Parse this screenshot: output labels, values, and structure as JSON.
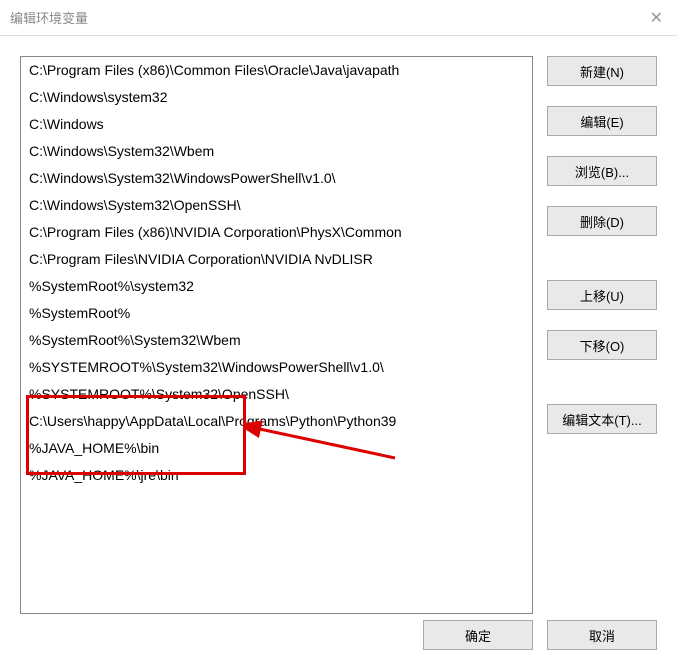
{
  "window": {
    "title": "编辑环境变量",
    "close_glyph": "✕"
  },
  "paths": [
    "C:\\Program Files (x86)\\Common Files\\Oracle\\Java\\javapath",
    "C:\\Windows\\system32",
    "C:\\Windows",
    "C:\\Windows\\System32\\Wbem",
    "C:\\Windows\\System32\\WindowsPowerShell\\v1.0\\",
    "C:\\Windows\\System32\\OpenSSH\\",
    "C:\\Program Files (x86)\\NVIDIA Corporation\\PhysX\\Common",
    "C:\\Program Files\\NVIDIA Corporation\\NVIDIA NvDLISR",
    "%SystemRoot%\\system32",
    "%SystemRoot%",
    "%SystemRoot%\\System32\\Wbem",
    "%SYSTEMROOT%\\System32\\WindowsPowerShell\\v1.0\\",
    "%SYSTEMROOT%\\System32\\OpenSSH\\",
    "C:\\Users\\happy\\AppData\\Local\\Programs\\Python\\Python39",
    "%JAVA_HOME%\\bin",
    "%JAVA_HOME%\\jre\\bin"
  ],
  "buttons": {
    "new": "新建(N)",
    "edit": "编辑(E)",
    "browse": "浏览(B)...",
    "delete": "删除(D)",
    "moveup": "上移(U)",
    "movedown": "下移(O)",
    "edittext": "编辑文本(T)...",
    "ok": "确定",
    "cancel": "取消"
  }
}
